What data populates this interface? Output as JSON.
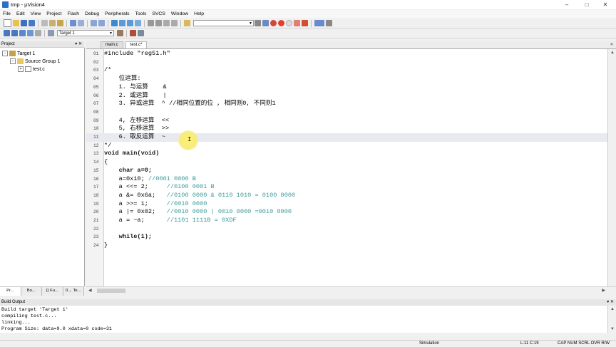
{
  "window": {
    "title": "tmp - µVision4",
    "minimize": "–",
    "maximize": "□",
    "close": "✕"
  },
  "menu": [
    "File",
    "Edit",
    "View",
    "Project",
    "Flash",
    "Debug",
    "Peripherals",
    "Tools",
    "SVCS",
    "Window",
    "Help"
  ],
  "toolbar2": {
    "target_combo": "Target 1"
  },
  "project": {
    "title": "Project",
    "tree": [
      {
        "label": "Target 1",
        "level": 0
      },
      {
        "label": "Source Group 1",
        "level": 1
      },
      {
        "label": "test.c",
        "level": 2
      }
    ],
    "tabs": [
      "Pr...",
      "Bo...",
      "{} Fu...",
      "0→ Te..."
    ]
  },
  "editor": {
    "tabs": [
      "main.c",
      "test.c*"
    ],
    "lines": [
      {
        "n": "01",
        "code": "#include \"reg51.h\"",
        "comment": ""
      },
      {
        "n": "02",
        "code": "",
        "comment": ""
      },
      {
        "n": "03",
        "code": "/*",
        "comment": ""
      },
      {
        "n": "04",
        "code": "    位运算:",
        "comment": ""
      },
      {
        "n": "05",
        "code": "    1. 与运算    &",
        "comment": ""
      },
      {
        "n": "06",
        "code": "    2. 或运算    |",
        "comment": ""
      },
      {
        "n": "07",
        "code": "    3. 异或运算  ^ //相同位置的位 , 相同则0, 不同则1",
        "comment": ""
      },
      {
        "n": "08",
        "code": "",
        "comment": ""
      },
      {
        "n": "09",
        "code": "    4, 左移运算  <<",
        "comment": ""
      },
      {
        "n": "10",
        "code": "    5, 右移运算  >>",
        "comment": ""
      },
      {
        "n": "11",
        "code": "    6. 取反运算  ~",
        "comment": ""
      },
      {
        "n": "12",
        "code": "*/",
        "comment": ""
      },
      {
        "n": "13",
        "code": "void main(void)",
        "comment": ""
      },
      {
        "n": "14",
        "code": "{",
        "comment": ""
      },
      {
        "n": "15",
        "code": "    char a=0;",
        "comment": ""
      },
      {
        "n": "16",
        "code": "    a=0x10; ",
        "comment": "//0001 0000 B"
      },
      {
        "n": "17",
        "code": "    a <<= 2;     ",
        "comment": "//0100 0001 B"
      },
      {
        "n": "18",
        "code": "    a &= 0x6a;   ",
        "comment": "//0100 0000 & 0110 1010 = 0100 0000"
      },
      {
        "n": "19",
        "code": "    a >>= 1;     ",
        "comment": "//0010 0000"
      },
      {
        "n": "20",
        "code": "    a |= 0x02;   ",
        "comment": "//0010 0000 | 0010 0000 =0010 0000"
      },
      {
        "n": "21",
        "code": "    a = ~a;      ",
        "comment": "//1101 1111B = 0XDF"
      },
      {
        "n": "22",
        "code": "",
        "comment": ""
      },
      {
        "n": "23",
        "code": "    while(1);",
        "comment": ""
      },
      {
        "n": "24",
        "code": "}",
        "comment": ""
      }
    ],
    "highlighted_line": "11"
  },
  "build": {
    "title": "Build Output",
    "lines": [
      "Build target 'Target 1'",
      "compiling test.c...",
      "linking...",
      "Program Size: data=9.0 xdata=0 code=31"
    ]
  },
  "status": {
    "mode": "Simulation",
    "position": "L:11 C:19",
    "flags": "CAP  NUM  SCRL  OVR  R/W"
  }
}
